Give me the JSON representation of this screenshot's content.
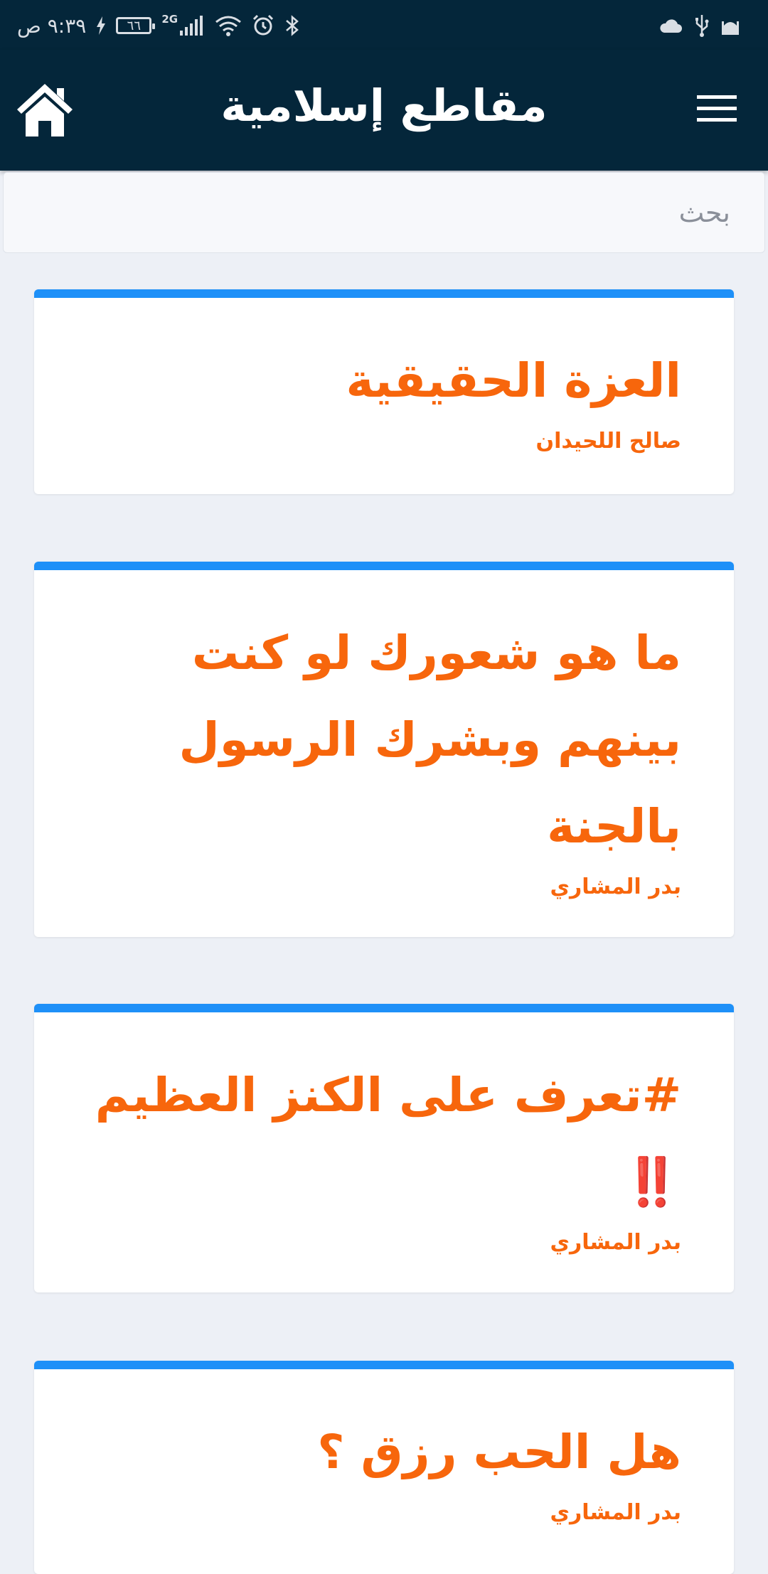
{
  "status_bar": {
    "time": "٩:٣٩ ص",
    "battery": "٦٦",
    "network": "2G"
  },
  "header": {
    "title": "مقاطع إسلامية"
  },
  "search": {
    "placeholder": "بحث"
  },
  "cards": [
    {
      "title": "العزة الحقيقية",
      "author": "صالح اللحيدان"
    },
    {
      "title": "ما هو شعورك لو كنت بينهم وبشرك الرسول بالجنة",
      "author": "بدر المشاري"
    },
    {
      "title": "#تعرف على الكنز العظيم",
      "title_mark": "‼️",
      "author": "بدر المشاري"
    },
    {
      "title": "هل الحب رزق ؟",
      "author": "بدر المشاري"
    }
  ],
  "colors": {
    "header_bg": "#04263a",
    "page_bg": "#edf0f6",
    "card_accent": "#1e90f8",
    "title_text": "#f7660c"
  }
}
